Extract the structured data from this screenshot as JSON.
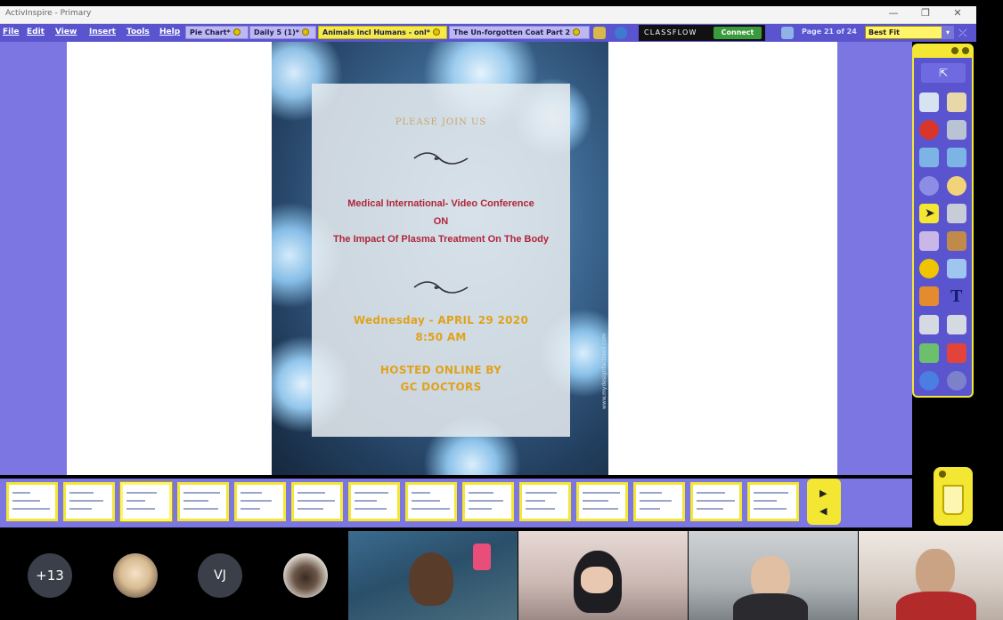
{
  "window": {
    "title": "ActivInspire - Primary",
    "controls": {
      "minimize": "—",
      "restore": "❐",
      "close": "✕"
    }
  },
  "menu": [
    "File",
    "Edit",
    "View",
    "Insert",
    "Tools",
    "Help"
  ],
  "tabs": [
    {
      "label": "Pie Chart*",
      "active": false
    },
    {
      "label": "Daily 5 (1)*",
      "active": false
    },
    {
      "label": "Animals incl Humans - onl*",
      "active": true
    },
    {
      "label": "The Un-forgotten Coat Part 2",
      "active": false
    }
  ],
  "classflow": {
    "label": "CLASSFLOW",
    "button": "Connect"
  },
  "page_indicator": "Page 21 of 24",
  "zoom": {
    "value": "Best Fit",
    "arrow": "▾"
  },
  "poster": {
    "invite": "PLEASE JOIN US",
    "line1": "Medical International- Video Conference",
    "line2": "ON",
    "line3": "The Impact Of Plasma Treatment On The Body",
    "date": "Wednesday -  APRIL 29 2020",
    "time": "8:50 AM",
    "host1": "HOSTED ONLINE BY",
    "host2": "GC DOCTORS",
    "credit": "www.mydesignfactored.com"
  },
  "page_strip": {
    "count": 14,
    "current_index": 2,
    "nav_next": "▶",
    "nav_prev": "◀"
  },
  "call": {
    "more_participants": "+13",
    "initials": "VJ"
  },
  "colors": {
    "workspace": "#7b76e2",
    "menubar": "#5a55cf",
    "accent_yellow": "#f4e733",
    "conference_red": "#b0263a",
    "date_gold": "#e0a21c"
  }
}
